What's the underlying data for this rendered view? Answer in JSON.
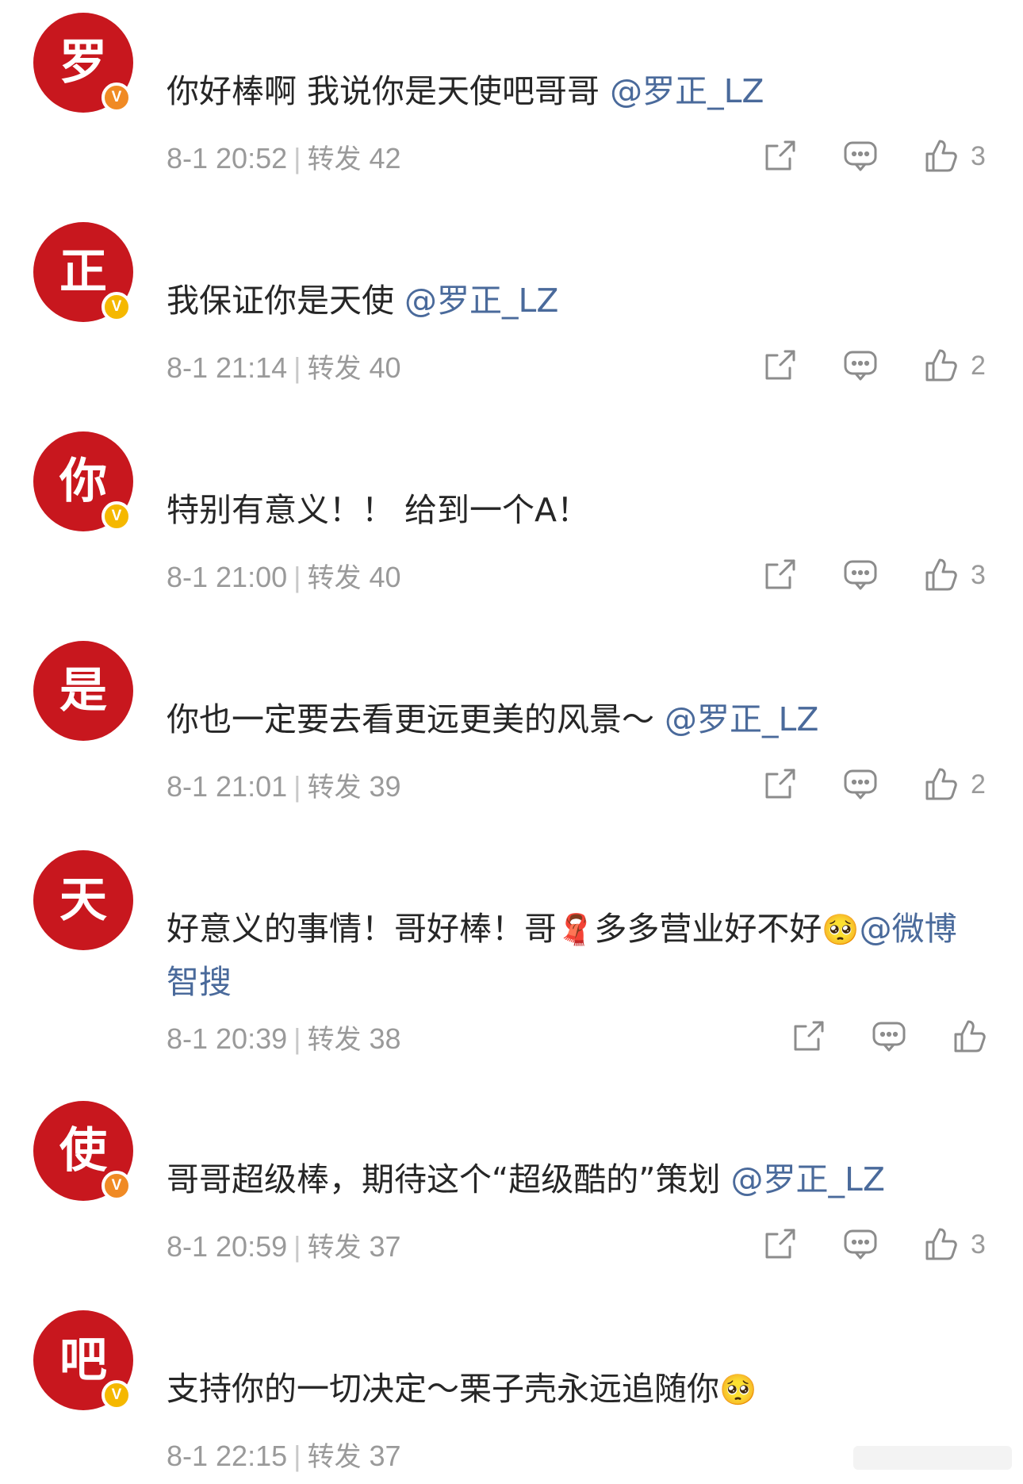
{
  "colors": {
    "avatar_bg": "#c8171e",
    "badge_orange": "#f08a24",
    "badge_yellow": "#f5b800",
    "mention": "#4a6a9b",
    "meta_gray": "#9a9a9a"
  },
  "icons": [
    "share-icon",
    "comment-icon",
    "like-icon"
  ],
  "comments": [
    {
      "avatar": "罗",
      "badge": "V",
      "badge_color": "orange",
      "text": "你好棒啊 我说你是天使吧哥哥",
      "mention": "@罗正_LZ",
      "time": "8-1 20:52",
      "repost_label": "转发",
      "repost_count": "42",
      "likes": "3"
    },
    {
      "avatar": "正",
      "badge": "V",
      "badge_color": "yellow",
      "text": "我保证你是天使",
      "mention": "@罗正_LZ",
      "time": "8-1 21:14",
      "repost_label": "转发",
      "repost_count": "40",
      "likes": "2"
    },
    {
      "avatar": "你",
      "badge": "V",
      "badge_color": "yellow",
      "text": "特别有意义！！ 给到一个A！",
      "mention": "",
      "time": "8-1 21:00",
      "repost_label": "转发",
      "repost_count": "40",
      "likes": "3"
    },
    {
      "avatar": "是",
      "badge": "",
      "badge_color": "",
      "text": "你也一定要去看更远更美的风景～",
      "mention": "@罗正_LZ",
      "time": "8-1 21:01",
      "repost_label": "转发",
      "repost_count": "39",
      "likes": "2"
    },
    {
      "avatar": "天",
      "badge": "",
      "badge_color": "",
      "text": "好意义的事情！哥好棒！哥",
      "text_emoji_1": "🧣",
      "text_2": "多多营业好不好",
      "text_emoji_2": "🥺",
      "mention": "@微博智搜",
      "time": "8-1 20:39",
      "repost_label": "转发",
      "repost_count": "38",
      "likes": ""
    },
    {
      "avatar": "使",
      "badge": "V",
      "badge_color": "orange",
      "text": "哥哥超级棒，期待这个“超级酷的”策划",
      "mention": "@罗正_LZ",
      "time": "8-1 20:59",
      "repost_label": "转发",
      "repost_count": "37",
      "likes": "3"
    },
    {
      "avatar": "吧",
      "badge": "V",
      "badge_color": "yellow",
      "text": "支持你的一切决定～栗子壳永远追随你",
      "text_emoji_1": "🥺",
      "mention": "",
      "time": "8-1 22:15",
      "repost_label": "转发",
      "repost_count": "37",
      "likes": ""
    }
  ]
}
